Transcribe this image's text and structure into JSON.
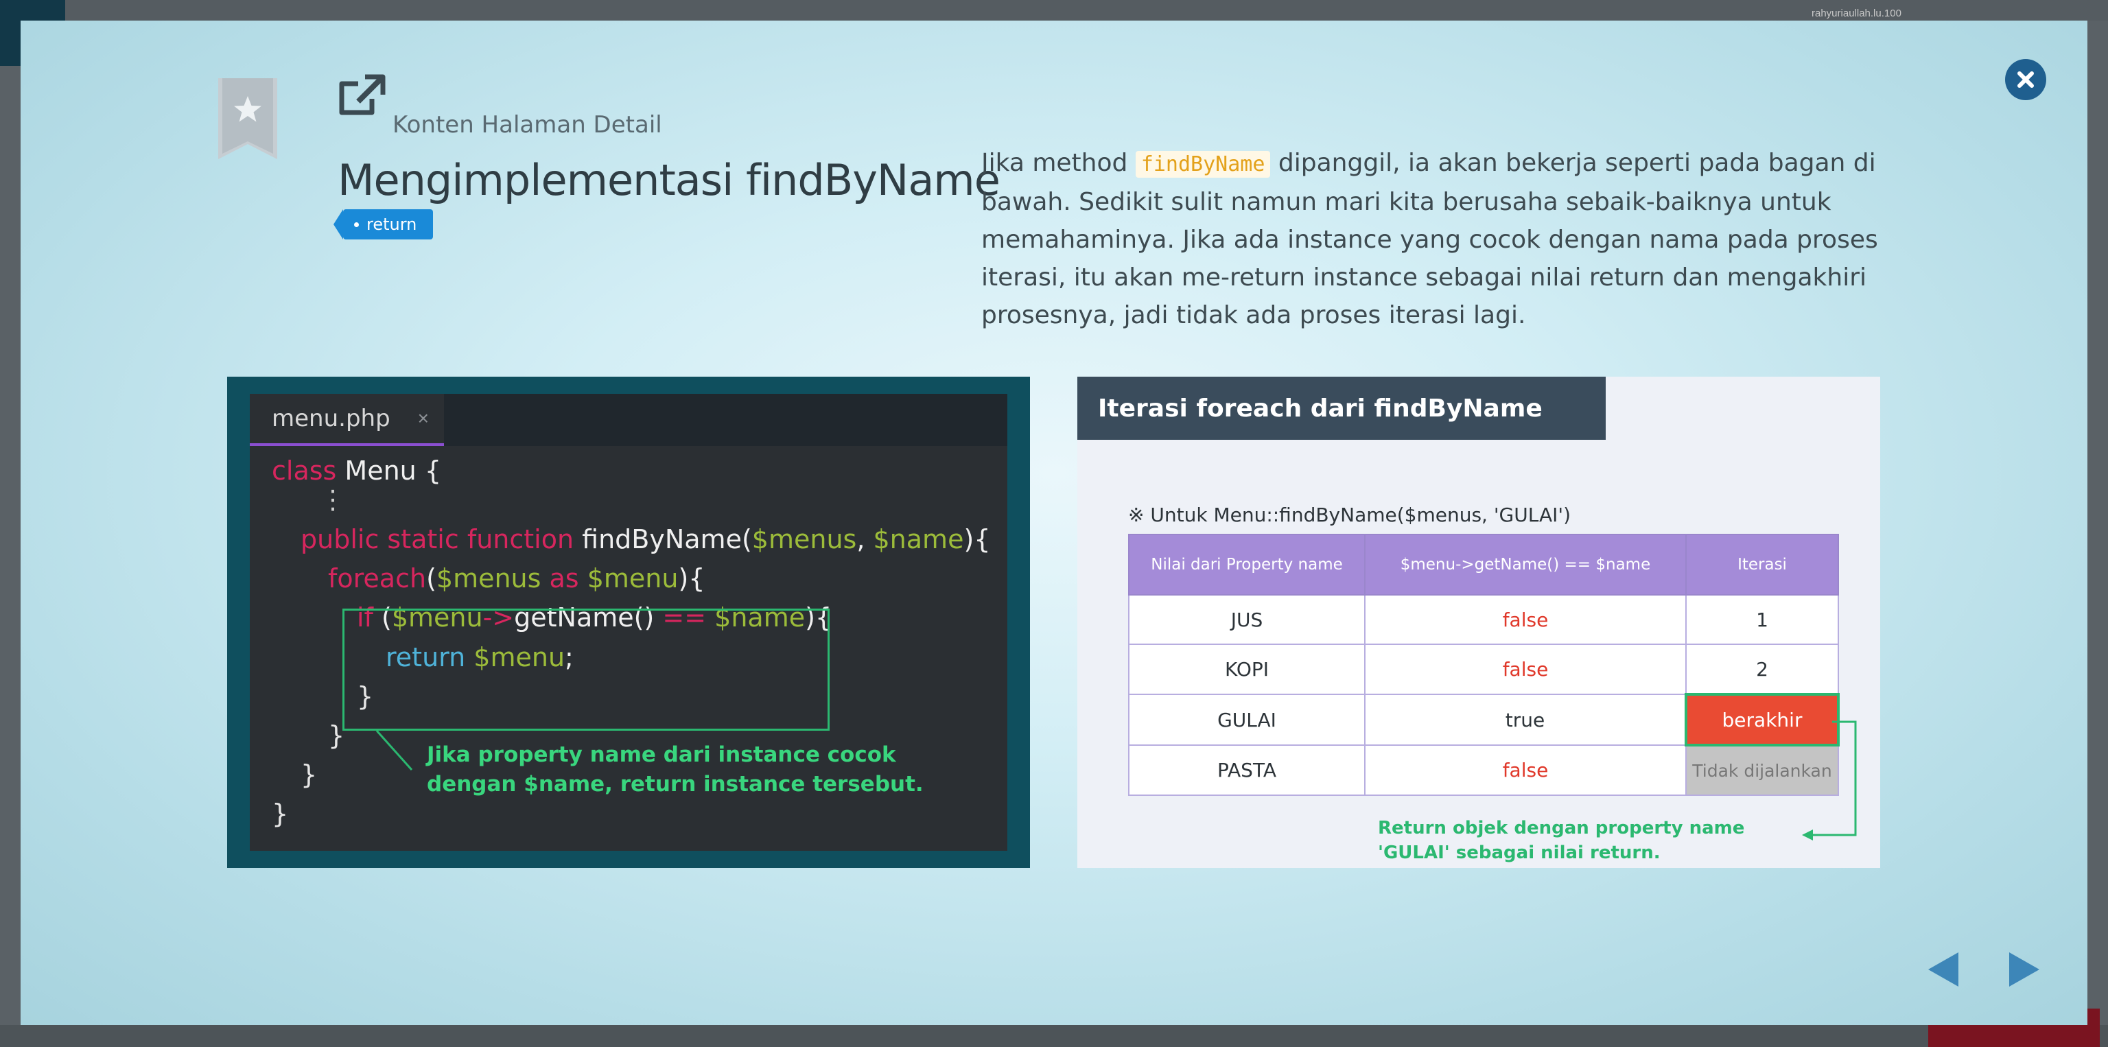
{
  "background": {
    "username": "rahyuriaullah.lu.100"
  },
  "modal": {
    "subtitle": "Konten Halaman Detail",
    "title": "Mengimplementasi findByName",
    "tag": "return",
    "description": {
      "before_code": "Jika method ",
      "code": "findByName",
      "after_code": " dipanggil, ia akan bekerja seperti pada bagan di bawah. Sedikit sulit namun mari kita berusaha sebaik-baiknya untuk memahaminya. Jika ada instance yang cocok dengan nama pada proses iterasi, itu akan me-return instance sebagai nilai return dan mengakhiri prosesnya, jadi tidak ada proses iterasi lagi."
    }
  },
  "code_panel": {
    "tab_name": "menu.php",
    "tab_close": "×",
    "lines": {
      "l1_kw": "class",
      "l1_rest": " Menu {",
      "l2": "⋮",
      "l3_kw": "public static function",
      "l3_fn": " findByName(",
      "l3_v1": "$menus",
      "l3_sep": ", ",
      "l3_v2": "$name",
      "l3_end": "){",
      "l4_kw": "foreach",
      "l4_p": "(",
      "l4_v1": "$menus",
      "l4_as": " as ",
      "l4_v2": "$menu",
      "l4_end": "){",
      "l5_kw": "if",
      "l5_p": " (",
      "l5_v1": "$menu",
      "l5_arrow": "->",
      "l5_fn": "getName()",
      "l5_eq": " == ",
      "l5_v2": "$name",
      "l5_end": "){",
      "l6_kw": "return",
      "l6_v": " $menu",
      "l6_end": ";",
      "l7": "}",
      "l8": "}",
      "l9": "}",
      "l10": "}"
    },
    "note": "Jika property name dari instance cocok dengan $name, return instance tersebut."
  },
  "table_panel": {
    "header": "Iterasi foreach dari findByName",
    "caption": "※ Untuk Menu::findByName($menus, 'GULAI')",
    "columns": [
      "Nilai dari Property name",
      "$menu->getName() == $name",
      "Iterasi"
    ],
    "rows": [
      [
        "JUS",
        "false",
        "1"
      ],
      [
        "KOPI",
        "false",
        "2"
      ],
      [
        "GULAI",
        "true",
        "berakhir"
      ],
      [
        "PASTA",
        "false",
        "Tidak dijalankan"
      ]
    ],
    "note": "Return objek dengan property name 'GULAI' sebagai nilai return."
  },
  "colors": {
    "accent": "#1a8ad8",
    "highlight": "#2bb870",
    "end": "#e94b33",
    "table_head": "#a48bd8"
  },
  "icons": [
    "bookmark-star-icon",
    "external-link-icon",
    "close-icon",
    "arrow-left-icon",
    "arrow-right-icon"
  ]
}
